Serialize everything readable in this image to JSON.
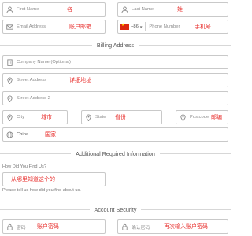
{
  "name": {
    "first_placeholder": "First Name",
    "first_note": "名",
    "last_placeholder": "Last Name",
    "last_note": "姓"
  },
  "contact": {
    "email_placeholder": "Email Address",
    "email_note": "账户邮箱",
    "phone_country_code": "+86",
    "phone_placeholder": "Phone Number",
    "phone_note": "手机号"
  },
  "billing": {
    "title": "Billing Address",
    "company_placeholder": "Company Name (Optional)",
    "street1_placeholder": "Street Address",
    "street1_note": "详细地址",
    "street2_placeholder": "Street Address 2",
    "city_placeholder": "City",
    "city_note": "城市",
    "state_placeholder": "State",
    "state_note": "省份",
    "postcode_placeholder": "Postcode",
    "postcode_note": "邮编",
    "country_value": "China",
    "country_note": "国家"
  },
  "additional": {
    "title": "Additional Required Information",
    "question_label": "How Did You Find Us?",
    "question_note": "从哪里知道这个的",
    "helper_text": "Please tell us how did you find about us."
  },
  "security": {
    "title": "Account Security",
    "password_placeholder": "密码",
    "password_note": "账户密码",
    "confirm_placeholder": "确认密码",
    "confirm_note": "再次输入账户密码"
  },
  "icons": [
    "user-icon",
    "envelope-icon",
    "building-icon",
    "map-marker-icon",
    "globe-icon",
    "lock-icon",
    "china-flag-icon",
    "caret-down-icon"
  ],
  "colors": {
    "note_red": "#e8312f",
    "border": "#c9c9c9",
    "flag_red": "#de2910"
  }
}
